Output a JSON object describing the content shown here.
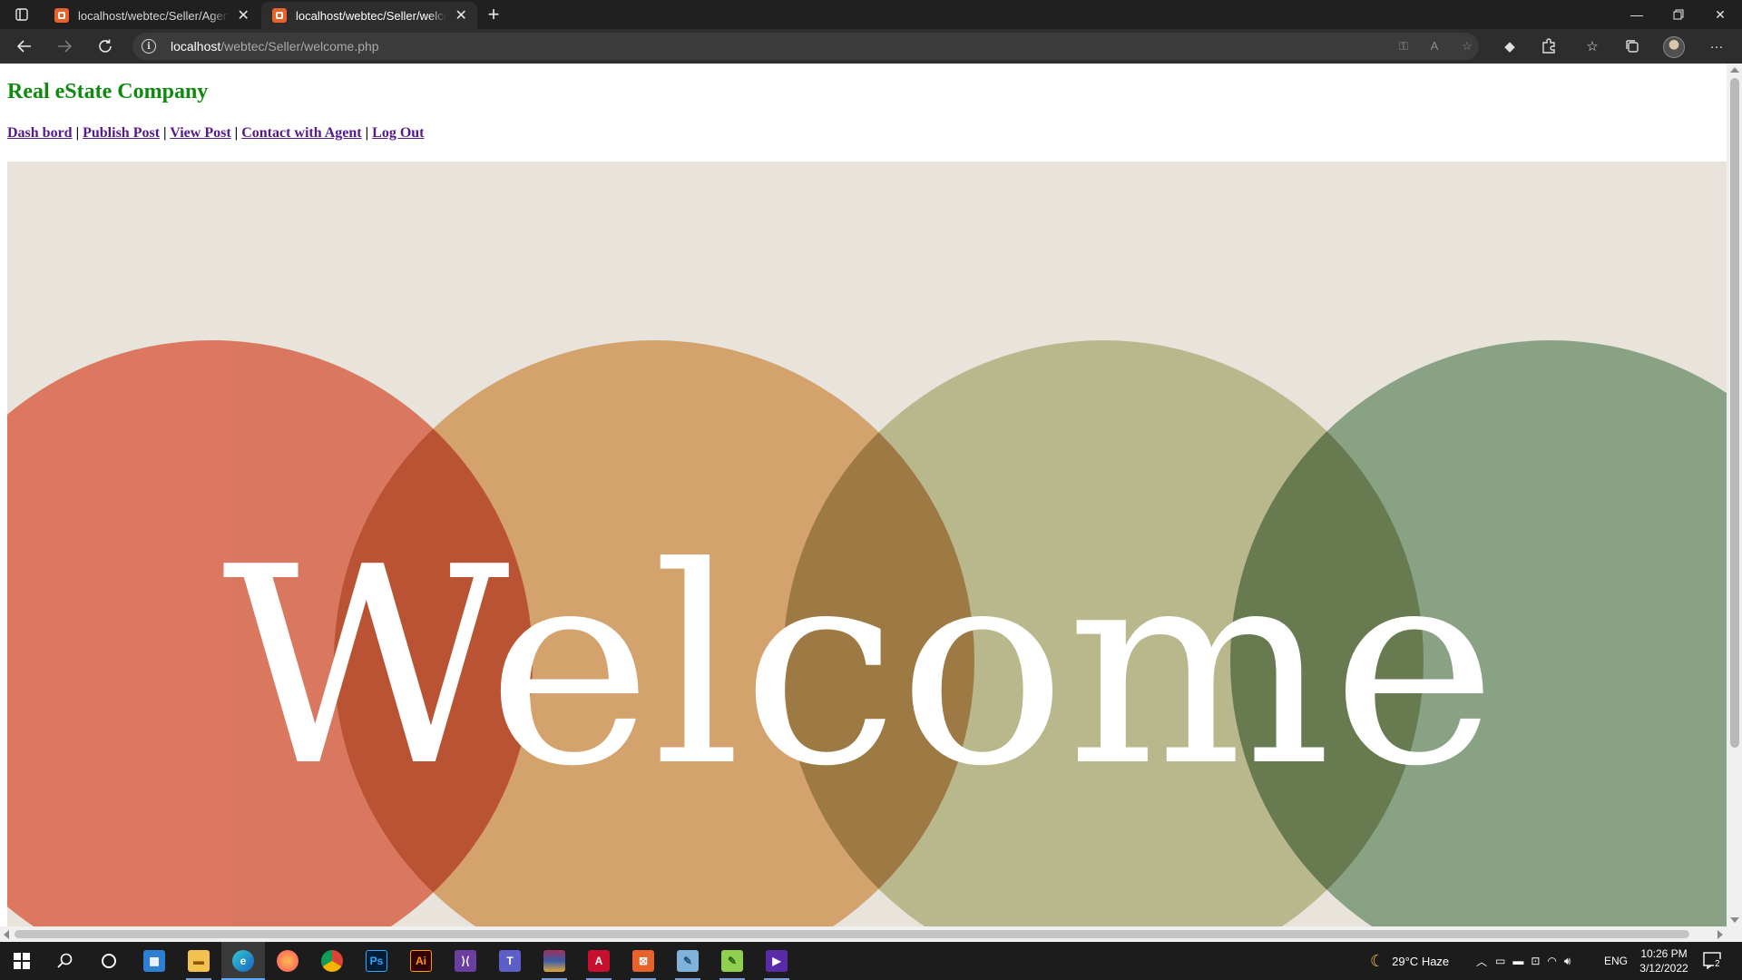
{
  "browser": {
    "tabs": [
      {
        "title": "localhost/webtec/Seller/Agent/a",
        "active": false
      },
      {
        "title": "localhost/webtec/Seller/welcome.php",
        "active": true
      }
    ],
    "address": {
      "host": "localhost",
      "path": "/webtec/Seller/welcome.php"
    }
  },
  "page": {
    "title": "Real eState Company",
    "nav": [
      "Dash bord",
      "Publish Post",
      "View Post",
      "Contact with Agent",
      "Log Out"
    ],
    "separator": " | ",
    "banner": {
      "text": "Welcome",
      "colors": {
        "background": "#e8e4db",
        "circle_red": "#d9694f",
        "circle_orange": "#d29a5d",
        "circle_olive": "#b3b382",
        "circle_green": "#7b9a78",
        "text": "#ffffff"
      }
    }
  },
  "taskbar": {
    "apps": [
      "windows-start",
      "search",
      "cortana",
      "microsoft-store",
      "file-explorer",
      "edge",
      "firefox",
      "chrome",
      "photoshop",
      "illustrator",
      "visual-studio",
      "teams",
      "winrar",
      "acrobat",
      "xampp",
      "notepad",
      "notepad-plus",
      "media-player"
    ],
    "weather": {
      "temp": "29°C",
      "condition": "Haze"
    },
    "language": "ENG",
    "time": "10:26 PM",
    "date": "3/12/2022",
    "notifications": "2"
  },
  "theme": {
    "title_color": "#0e8a0e",
    "link_color": "#551a8b"
  }
}
